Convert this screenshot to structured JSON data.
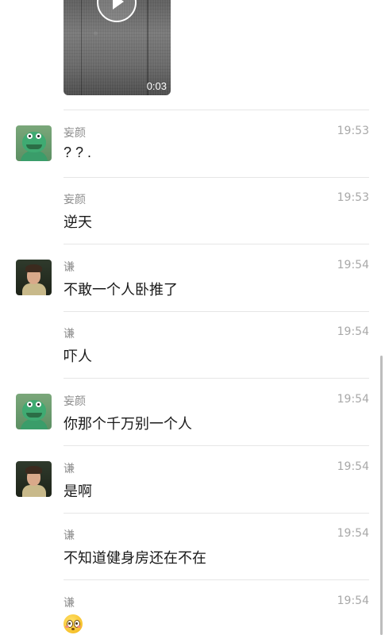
{
  "video": {
    "duration": "0:03",
    "icon": "play-icon"
  },
  "messages": [
    {
      "sender": "妄颜",
      "time": "19:53",
      "text": "? ? .",
      "avatar": "frog-avatar",
      "show_avatar": true
    },
    {
      "sender": "妄颜",
      "time": "19:53",
      "text": "逆天",
      "show_avatar": false
    },
    {
      "sender": "谦",
      "time": "19:54",
      "text": "不敢一个人卧推了",
      "avatar": "man-avatar",
      "show_avatar": true
    },
    {
      "sender": "谦",
      "time": "19:54",
      "text": "吓人",
      "show_avatar": false
    },
    {
      "sender": "妄颜",
      "time": "19:54",
      "text": "你那个千万别一个人",
      "avatar": "frog-avatar",
      "show_avatar": true
    },
    {
      "sender": "谦",
      "time": "19:54",
      "text": "是啊",
      "avatar": "man-avatar",
      "show_avatar": true
    },
    {
      "sender": "谦",
      "time": "19:54",
      "text": "不知道健身房还在不在",
      "show_avatar": false
    },
    {
      "sender": "谦",
      "time": "19:54",
      "emoji": "flushed-face-emoji",
      "show_avatar": false
    }
  ],
  "colors": {
    "name": "#8c8c8c",
    "time": "#a8a8a8",
    "text": "#1a1a1a",
    "divider": "#e6e6e6"
  }
}
